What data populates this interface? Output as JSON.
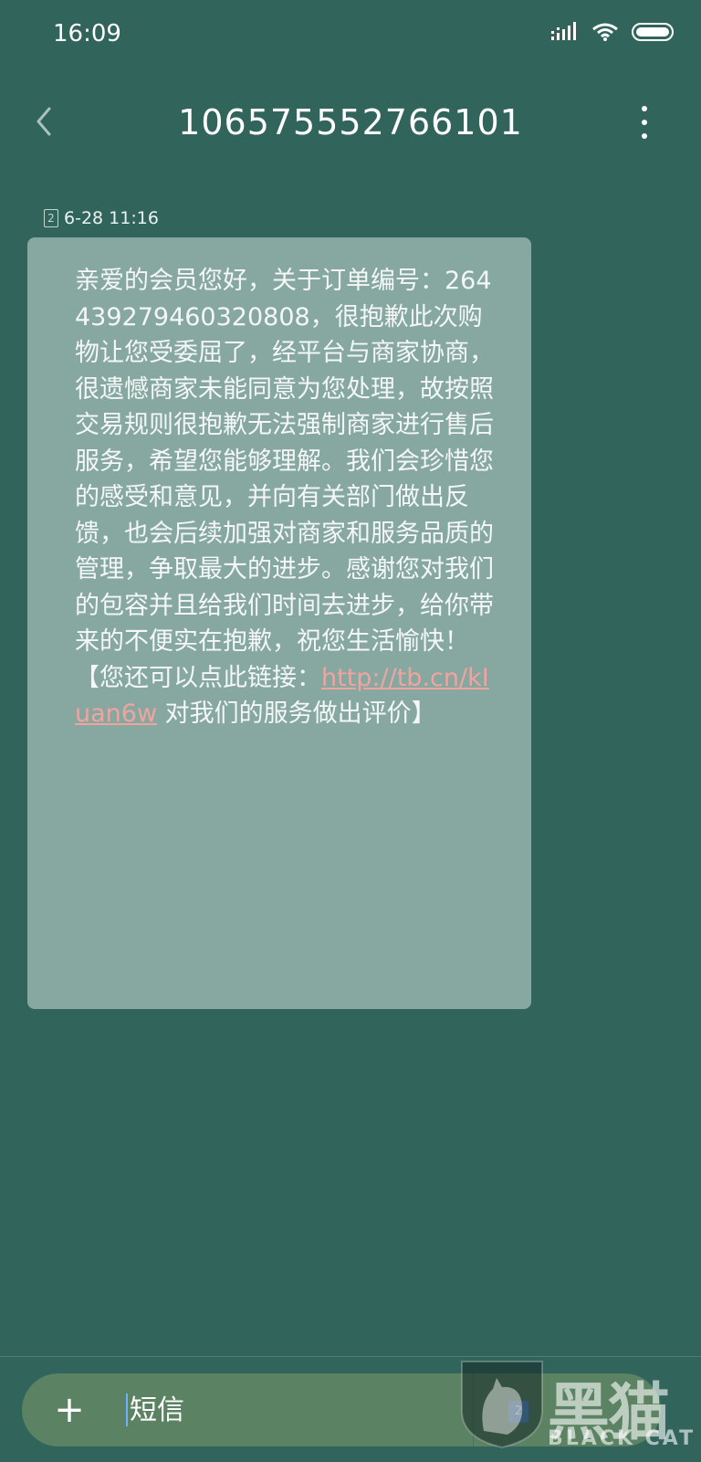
{
  "status_bar": {
    "time": "16:09",
    "icons": [
      "signal-icon",
      "wifi-icon",
      "battery-icon"
    ]
  },
  "header": {
    "title": "10657555276​6101",
    "back_icon": "chevron-left-icon",
    "more_icon": "more-vertical-icon"
  },
  "message": {
    "sim_slot": "2",
    "timestamp": "6-28 11:16",
    "body_before_link": "亲爱的会员您好，关于订单编号：264439279460320808，很抱歉此次购物让您受委屈了，经平台与商家协商，很遗憾商家未能同意为您处理，故按照交易规则很抱歉无法强制商家进行售后服务，希望您能够理解。我们会珍惜您的感受和意见，并向有关部门做出反馈，也会后续加强对商家和服务品质的管理，争取最大的进步。感谢您对我们的包容并且给我们时间去进步，给你带来的不便实在抱歉，祝您生活愉快！【您还可以点此链接：",
    "link": "http://tb.cn/kIuan6w",
    "body_after_link": " 对我们的服务做出评价】"
  },
  "composer": {
    "add_label": "+",
    "placeholder": "短信",
    "send_sim": "2"
  },
  "watermark": {
    "cn_text": "黑猫",
    "en_text": "BLACK CAT"
  },
  "colors": {
    "background": "#31655c",
    "bubble": "#86a8a1",
    "link": "#f1a49f",
    "input_pill": "#5b8262"
  }
}
